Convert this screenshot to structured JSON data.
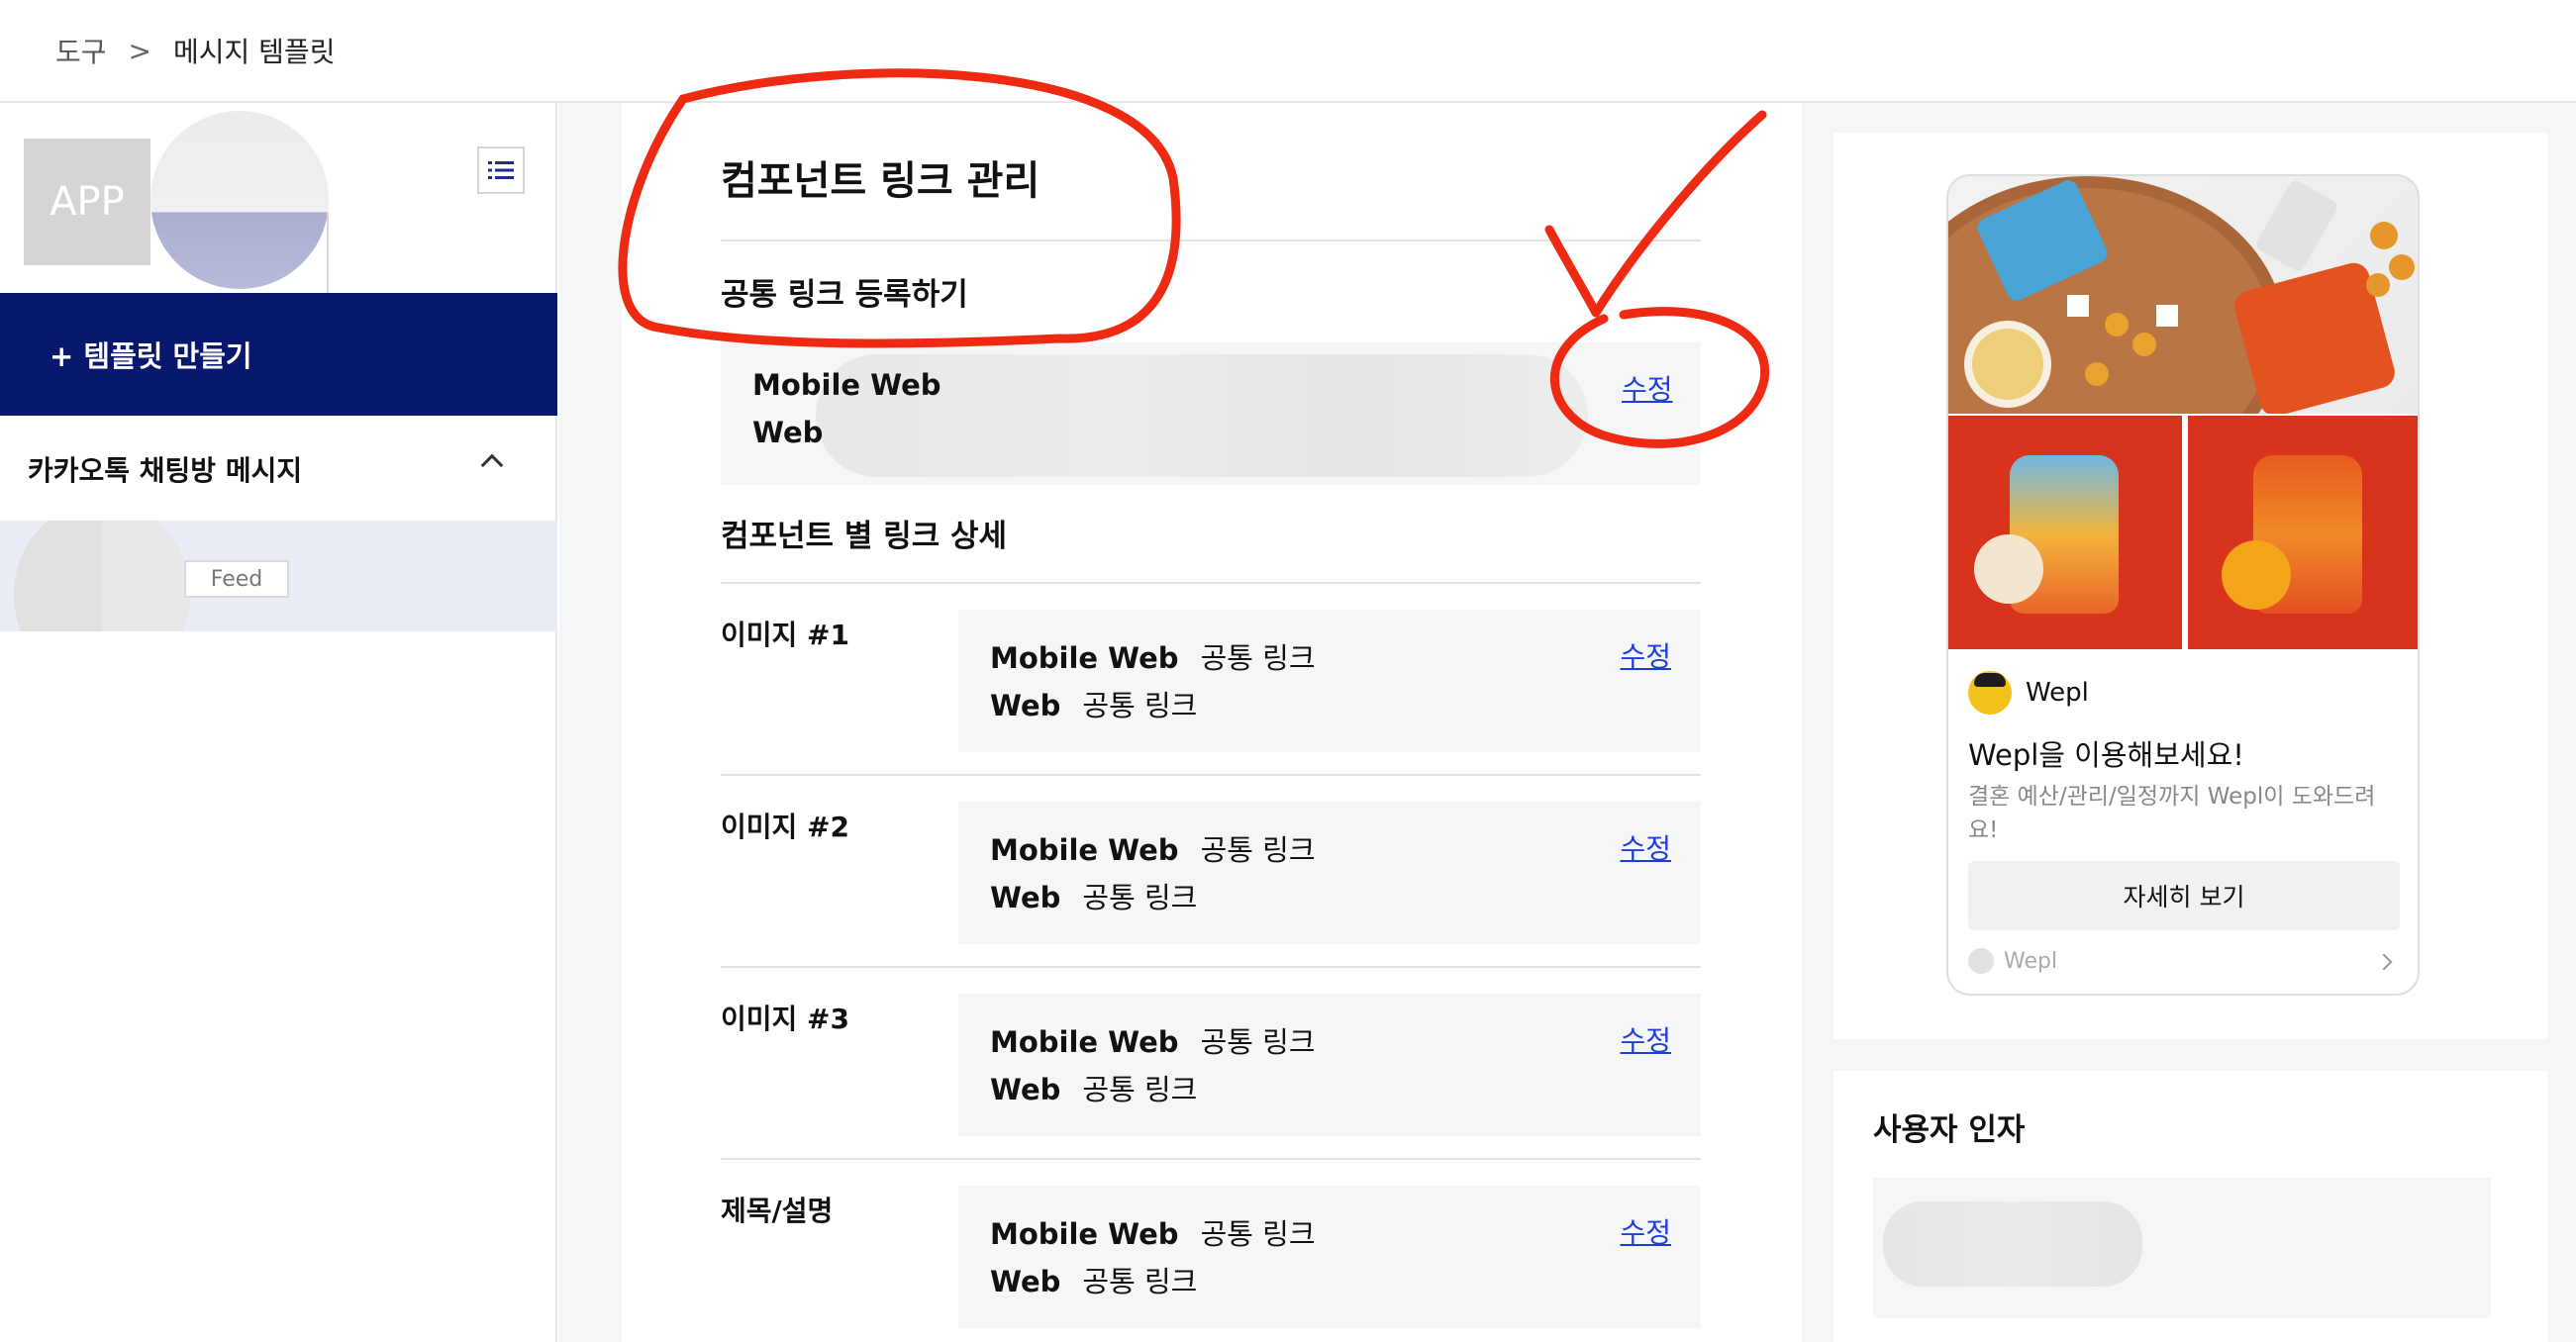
{
  "breadcrumb": {
    "root": "도구",
    "separator": ">",
    "current": "메시지 템플릿"
  },
  "sidebar": {
    "app_label": "APP",
    "create_button": "+ 템플릿 만들기",
    "section_title": "카카오톡 채팅방 메시지",
    "template_tag": "Feed"
  },
  "main": {
    "title": "컴포넌트 링크 관리",
    "common": {
      "title": "공통 링크 등록하기",
      "mobile_web_label": "Mobile Web",
      "web_label": "Web",
      "edit_label": "수정"
    },
    "detail_title": "컴포넌트 별 링크 상세",
    "rows": [
      {
        "label": "이미지 #1",
        "mobile_web_label": "Mobile Web",
        "mobile_web_value": "공통 링크",
        "web_label": "Web",
        "web_value": "공통 링크",
        "edit_label": "수정"
      },
      {
        "label": "이미지 #2",
        "mobile_web_label": "Mobile Web",
        "mobile_web_value": "공통 링크",
        "web_label": "Web",
        "web_value": "공통 링크",
        "edit_label": "수정"
      },
      {
        "label": "이미지 #3",
        "mobile_web_label": "Mobile Web",
        "mobile_web_value": "공통 링크",
        "web_label": "Web",
        "web_value": "공통 링크",
        "edit_label": "수정"
      },
      {
        "label": "제목/설명",
        "mobile_web_label": "Mobile Web",
        "mobile_web_value": "공통 링크",
        "web_label": "Web",
        "web_value": "공통 링크",
        "edit_label": "수정"
      }
    ]
  },
  "preview": {
    "brand": "Wepl",
    "title": "Wepl을 이용해보세요!",
    "description": "결혼 예산/관리/일정까지 Wepl이 도와드려요!",
    "button": "자세히 보기",
    "footer": "Wepl"
  },
  "user_args": {
    "title": "사용자 인자"
  },
  "colors": {
    "primary_navy": "#08186e",
    "link_blue": "#1f3fd4",
    "annotation_red": "#ee2a12",
    "panel_gray": "#f5f6f7",
    "selected_item": "#eaecf6",
    "image_red": "#d8331d"
  },
  "icons": {
    "list_view": "list-icon",
    "collapse": "chevron-up-icon",
    "footer_arrow": "chevron-right-icon"
  }
}
